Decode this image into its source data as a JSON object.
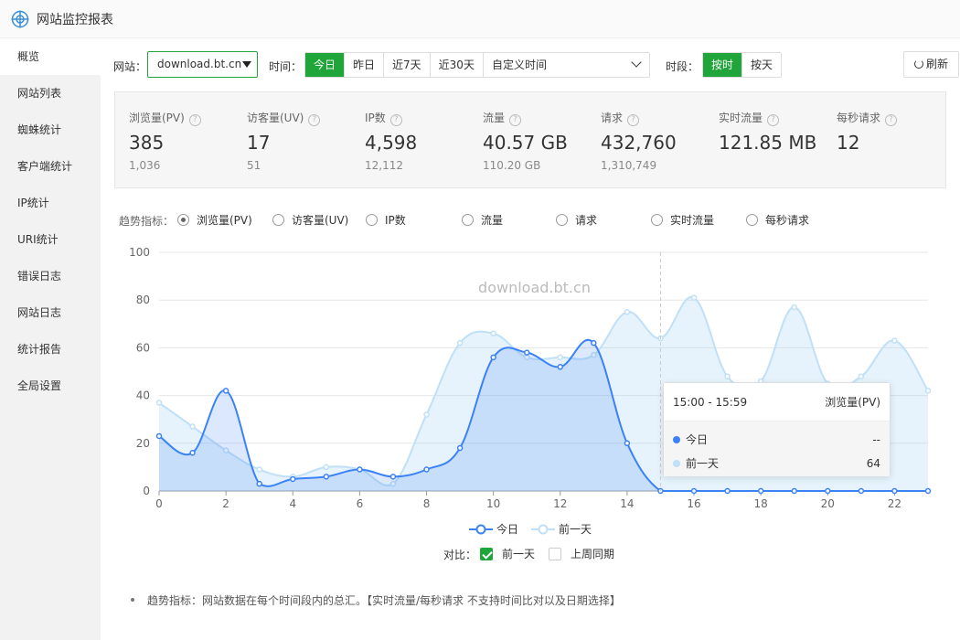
{
  "app": {
    "title": "网站监控报表",
    "logo_icon": "crosshair-target-icon"
  },
  "sidebar": {
    "items": [
      {
        "label": "概览",
        "active": true
      },
      {
        "label": "网站列表"
      },
      {
        "label": "蜘蛛统计"
      },
      {
        "label": "客户端统计"
      },
      {
        "label": "IP统计"
      },
      {
        "label": "URI统计"
      },
      {
        "label": "错误日志"
      },
      {
        "label": "网站日志"
      },
      {
        "label": "统计报告"
      },
      {
        "label": "全局设置"
      }
    ]
  },
  "toolbar": {
    "site_label": "网站：",
    "site_value": "download.bt.cn",
    "time_label": "时间：",
    "time_buttons": [
      "今日",
      "昨日",
      "近7天",
      "近30天"
    ],
    "time_active": "今日",
    "custom_time_placeholder": "自定义时间",
    "period_label": "时段：",
    "period_buttons": [
      "按时",
      "按天"
    ],
    "period_active": "按时",
    "refresh_label": "刷新"
  },
  "stats": [
    {
      "label": "浏览量(PV)",
      "value": "385",
      "prev": "1,036"
    },
    {
      "label": "访客量(UV)",
      "value": "17",
      "prev": "51"
    },
    {
      "label": "IP数",
      "value": "4,598",
      "prev": "12,112"
    },
    {
      "label": "流量",
      "value": "40.57 GB",
      "prev": "110.20 GB"
    },
    {
      "label": "请求",
      "value": "432,760",
      "prev": "1,310,749"
    },
    {
      "label": "实时流量",
      "value": "121.85 MB",
      "prev": ""
    },
    {
      "label": "每秒请求",
      "value": "12",
      "prev": ""
    }
  ],
  "trend": {
    "label": "趋势指标：",
    "options": [
      "浏览量(PV)",
      "访客量(UV)",
      "IP数",
      "流量",
      "请求",
      "实时流量",
      "每秒请求"
    ],
    "selected": "浏览量(PV)"
  },
  "chart_data": {
    "type": "area",
    "watermark": "download.bt.cn",
    "x": [
      0,
      1,
      2,
      3,
      4,
      5,
      6,
      7,
      8,
      9,
      10,
      11,
      12,
      13,
      14,
      15,
      16,
      17,
      18,
      19,
      20,
      21,
      22,
      23
    ],
    "x_ticks": [
      0,
      2,
      4,
      6,
      8,
      10,
      12,
      14,
      16,
      18,
      20,
      22
    ],
    "ylim": [
      0,
      100
    ],
    "y_ticks": [
      0,
      20,
      40,
      60,
      80,
      100
    ],
    "grid": true,
    "series": [
      {
        "name": "今日",
        "color": "#3b82f6",
        "values": [
          23,
          16,
          42,
          3,
          5,
          6,
          9,
          6,
          9,
          18,
          56,
          58,
          52,
          62,
          20,
          0,
          0,
          0,
          0,
          0,
          0,
          0,
          0,
          0
        ]
      },
      {
        "name": "前一天",
        "color": "#bfe0f7",
        "values": [
          37,
          27,
          17,
          9,
          6,
          10,
          9,
          3,
          32,
          62,
          66,
          56,
          56,
          57,
          75,
          64,
          81,
          48,
          46,
          77,
          45,
          48,
          63,
          42
        ]
      }
    ],
    "hover_x": 15,
    "tooltip": {
      "header_time": "15:00 - 15:59",
      "header_metric": "浏览量(PV)",
      "rows": [
        {
          "name": "今日",
          "value": "--",
          "color": "#3b82f6"
        },
        {
          "name": "前一天",
          "value": "64",
          "color": "#bfe0f7"
        }
      ]
    }
  },
  "compare": {
    "label": "对比：",
    "options": [
      {
        "label": "前一天",
        "checked": true
      },
      {
        "label": "上周同期",
        "checked": false
      }
    ]
  },
  "note": "趋势指标：网站数据在每个时间段内的总汇。【实时流量/每秒请求 不支持时间比对以及日期选择】"
}
